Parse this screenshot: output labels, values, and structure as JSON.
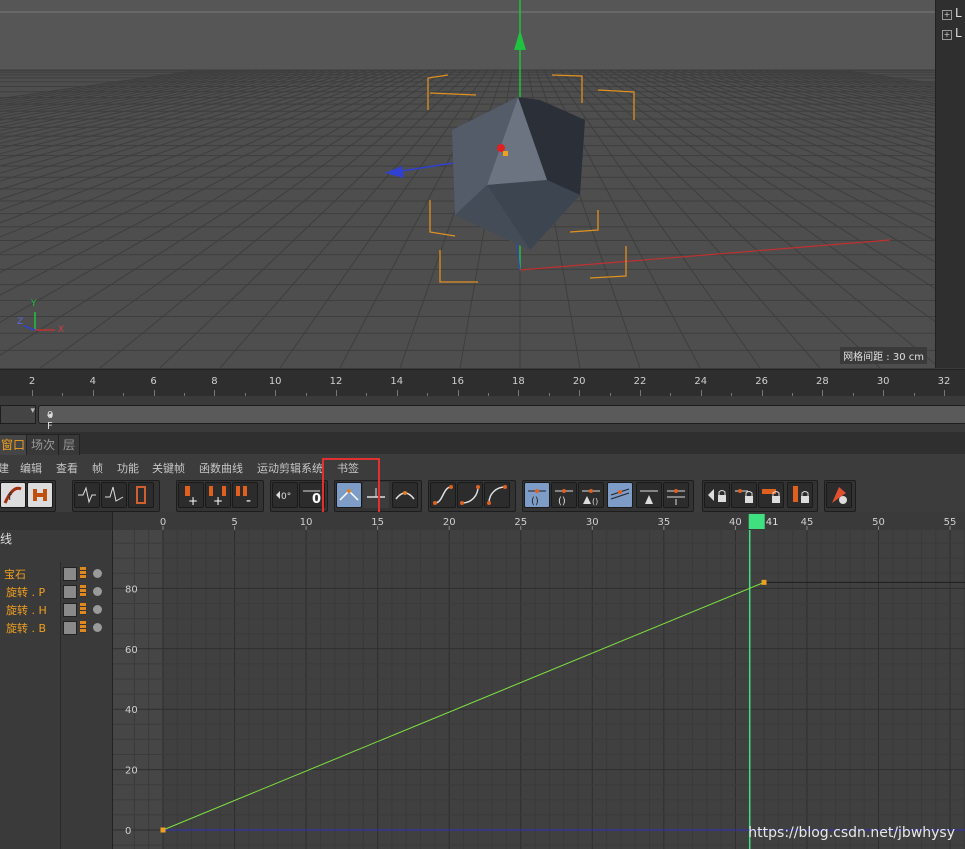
{
  "viewport": {
    "grid_spacing_label": "网格间距 : 30 cm",
    "axis_gizmo": {
      "y": "Y",
      "z": "Z",
      "x": "X"
    },
    "object_tree": [
      "L",
      "L"
    ]
  },
  "timeline": {
    "ruler_ticks": [
      "2",
      "4",
      "6",
      "8",
      "10",
      "12",
      "14",
      "16",
      "18",
      "20",
      "22",
      "24",
      "26",
      "28",
      "30",
      "32"
    ],
    "frame_value": "0 F"
  },
  "tabs": [
    {
      "label": "窗口",
      "active": true
    },
    {
      "label": "场次",
      "active": false
    },
    {
      "label": "层",
      "active": false
    }
  ],
  "menu": [
    "建",
    "编辑",
    "查看",
    "帧",
    "功能",
    "关键帧",
    "函数曲线",
    "运动剪辑系统",
    "书签"
  ],
  "toolbar": {
    "icons": [
      "fcurve-mode-icon",
      "dopesheet-mode-icon",
      "curve-wave-icon",
      "curve-wave-alt-icon",
      "curve-bracket-icon",
      "add-key-icon",
      "add-keys-icon",
      "add-keys-alt-icon",
      "delete-key-icon",
      "zero-angle-icon",
      "zero-value-icon",
      "spline-auto-tangent-icon",
      "spline-linear-icon",
      "spline-step-icon",
      "ease-curve-icon",
      "ease-in-icon",
      "ease-out-icon",
      "clamp-tangent-icon",
      "zero-tangent-icon",
      "lock-tangent-icon",
      "break-tangent-icon",
      "weight-tangent-icon",
      "unlock-tangent-icon",
      "lock-key-icon",
      "lock-time-icon",
      "lock-value-icon",
      "lock-all-icon",
      "record-icon"
    ],
    "zero_label": "0",
    "angle_label": "0°",
    "highlighted_tool": "spline-auto-tangent-icon"
  },
  "tracks": {
    "header_label": "线",
    "items": [
      "宝石",
      "旋转 . P",
      "旋转 . H",
      "旋转 . B"
    ]
  },
  "graph": {
    "current_frame": "41",
    "x_ticks": [
      "0",
      "5",
      "10",
      "15",
      "20",
      "25",
      "30",
      "35",
      "40",
      "45",
      "50",
      "55"
    ],
    "y_ticks": [
      "80",
      "60",
      "40",
      "20",
      "0"
    ]
  },
  "chart_data": {
    "type": "line",
    "x_range": [
      0,
      55
    ],
    "y_range": [
      0,
      90
    ],
    "series": [
      {
        "color": "#7ee040",
        "points": [
          [
            0,
            0
          ],
          [
            42,
            82
          ]
        ],
        "extend_after": 82
      },
      {
        "color": "#3030c0",
        "points": [
          [
            0,
            0
          ],
          [
            42,
            0
          ]
        ],
        "extend_after": 0
      }
    ],
    "keyframes": [
      [
        0,
        0
      ],
      [
        42,
        82
      ]
    ]
  },
  "watermark": "https://blog.csdn.net/jbwhysy",
  "colors": {
    "accent": "#f0a020",
    "highlight_box": "#e03030",
    "current_frame": "#3ee080"
  }
}
